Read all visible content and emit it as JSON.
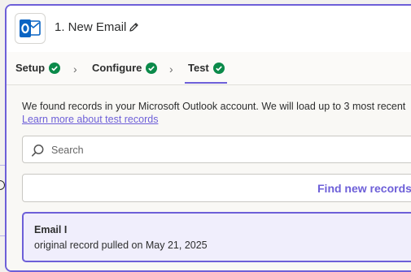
{
  "header": {
    "app_icon": "outlook-icon",
    "step_title": "1. New Email",
    "edit_icon": "pencil-icon"
  },
  "tabs": [
    {
      "label": "Setup",
      "status": "complete"
    },
    {
      "label": "Configure",
      "status": "complete"
    },
    {
      "label": "Test",
      "status": "complete",
      "active": true
    }
  ],
  "info": {
    "text": "We found records in your Microsoft Outlook account. We will load up to 3 most recent",
    "link": "Learn more about test records"
  },
  "search": {
    "placeholder": "Search"
  },
  "find_button": {
    "label": "Find new records"
  },
  "record": {
    "title": "Email I",
    "subtitle": "original record pulled on May 21, 2025"
  },
  "colors": {
    "accent": "#6d5fd8",
    "success": "#0b8a4a",
    "outlook_blue": "#0a64c3"
  }
}
